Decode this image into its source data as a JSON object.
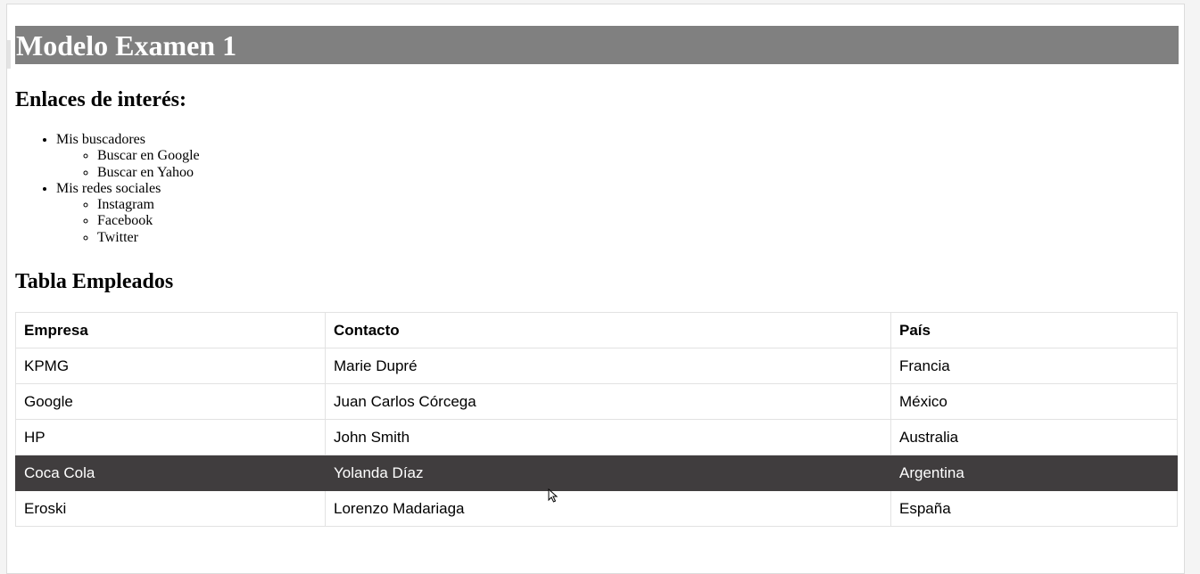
{
  "page": {
    "title": "Modelo Examen 1",
    "links_heading": "Enlaces de interés:",
    "table_heading": "Tabla Empleados"
  },
  "links": [
    {
      "label": "Mis buscadores",
      "children": [
        "Buscar en Google",
        "Buscar en Yahoo"
      ]
    },
    {
      "label": "Mis redes sociales",
      "children": [
        "Instagram",
        "Facebook",
        "Twitter"
      ]
    }
  ],
  "table": {
    "headers": [
      "Empresa",
      "Contacto",
      "País"
    ],
    "rows": [
      [
        "KPMG",
        "Marie Dupré",
        "Francia"
      ],
      [
        "Google",
        "Juan Carlos Córcega",
        "México"
      ],
      [
        "HP",
        "John Smith",
        "Australia"
      ],
      [
        "Coca Cola",
        "Yolanda Díaz",
        "Argentina"
      ],
      [
        "Eroski",
        "Lorenzo Madariaga",
        "España"
      ]
    ],
    "highlighted_row": 3
  },
  "colors": {
    "title_bg": "#808080",
    "highlight_bg": "#403d3e"
  },
  "icons": {
    "cursor": "mouse-pointer-icon"
  }
}
